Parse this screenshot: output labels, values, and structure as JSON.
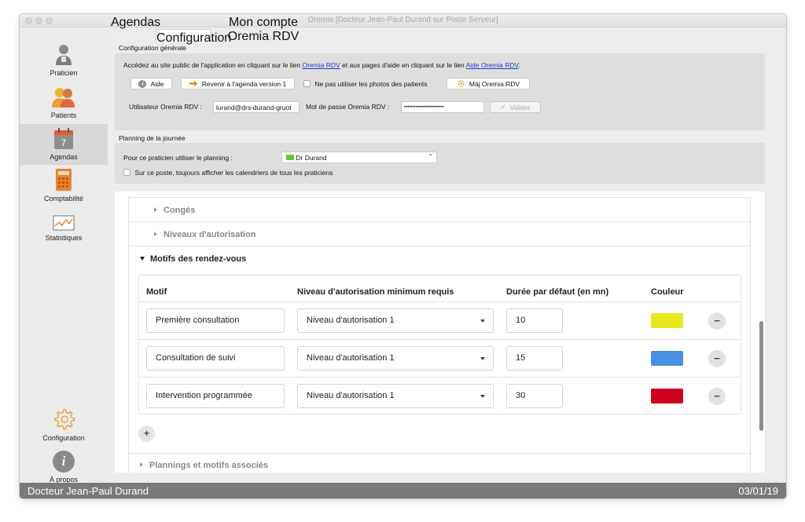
{
  "window": {
    "title": "Oremia [Docteur Jean-Paul Durand sur Poste Serveur]"
  },
  "sidebar": {
    "items": [
      {
        "label": "Praticien",
        "icon": "doctor-icon"
      },
      {
        "label": "Patients",
        "icon": "patients-icon"
      },
      {
        "label": "Agendas",
        "icon": "calendar-icon",
        "badge": "7",
        "active": true
      },
      {
        "label": "Comptabilité",
        "icon": "calculator-icon"
      },
      {
        "label": "Statistiques",
        "icon": "chart-icon"
      },
      {
        "label": "Configuration",
        "icon": "gear-icon"
      },
      {
        "label": "À propos",
        "icon": "info-icon",
        "glyph": "i"
      }
    ]
  },
  "tabs": [
    {
      "label": "Agendas"
    },
    {
      "label": "Configuration",
      "active": true
    },
    {
      "label": "Mon compte Oremia RDV"
    }
  ],
  "general": {
    "title": "Configuration générale",
    "info_prefix": "Accédez au site public de l'application en cliquant sur le lien ",
    "info_link1": "Oremia RDV",
    "info_middle": " et aux pages d'aide en cliquant sur le lien ",
    "info_link2": "Aide Oremia RDV",
    "info_suffix": ".",
    "help_button": "Aide",
    "back_button": "Revenir à l'agenda version 1",
    "no_photos_label": "Ne pas utiliser les photos des patients",
    "update_button": "Màj Oremia RDV",
    "user_label": "Utilisateur Oremia RDV :",
    "user_value": "lurand@drs-durand-gruot",
    "password_label": "Mot de passe Oremia RDV :",
    "password_value": "••••••••••••••••••••••••",
    "validate_button": "Valider"
  },
  "planning": {
    "title": "Planning de la journée",
    "practitioner_label": "Pour ce praticien utiliser le planning :",
    "practitioner_value": "Dr Durand",
    "practitioner_color": "#5ccb2e",
    "all_calendars_label": "Sur ce poste, toujours afficher les calendriers de tous les praticiens"
  },
  "sections": {
    "conges": "Congés",
    "niveaux": "Niveaux d'autorisation",
    "motifs": "Motifs des rendez-vous",
    "plannings": "Plannings et motifs associés"
  },
  "motifs_table": {
    "headers": [
      "Motif",
      "Niveau d'autorisation minimum requis",
      "Durée par défaut (en mn)",
      "Couleur"
    ],
    "rows": [
      {
        "motif": "Première consultation",
        "niveau": "Niveau d'autorisation 1",
        "duree": "10",
        "color": "#e8e81e"
      },
      {
        "motif": "Consultation de suivi",
        "niveau": "Niveau d'autorisation 1",
        "duree": "15",
        "color": "#4a90e2"
      },
      {
        "motif": "Intervention programmée",
        "niveau": "Niveau d'autorisation 1",
        "duree": "30",
        "color": "#d0021b"
      }
    ],
    "remove_glyph": "−",
    "add_glyph": "+"
  },
  "statusbar": {
    "user": "Docteur Jean-Paul Durand",
    "date": "03/01/19"
  }
}
